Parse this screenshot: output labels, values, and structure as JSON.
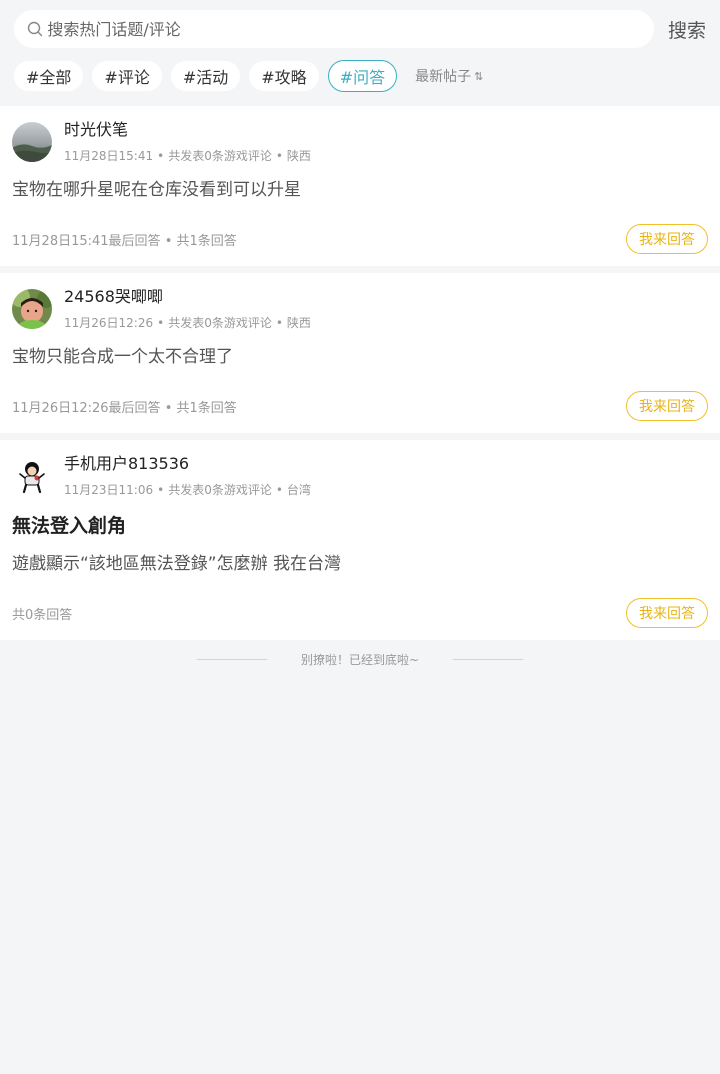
{
  "search": {
    "placeholder": "搜索热门话题/评论",
    "button_label": "搜索"
  },
  "filters": {
    "tags": [
      {
        "label": "#全部"
      },
      {
        "label": "#评论"
      },
      {
        "label": "#活动"
      },
      {
        "label": "#攻略"
      },
      {
        "label": "#问答"
      }
    ],
    "active_tag": "#问答",
    "sort_label": "最新帖子",
    "sort_icon": "⇅"
  },
  "colors": {
    "active_tag": "#3aafc3",
    "answer_button": "#e8b418",
    "background": "#f4f5f7"
  },
  "posts": [
    {
      "username": "时光伏笔",
      "time": "11月28日15:41",
      "comment_count": "共发表0条游戏评论",
      "location": "陕西",
      "title": "",
      "body": "宝物在哪升星呢在仓库没看到可以升星",
      "last_answer": "11月28日15:41最后回答",
      "answer_count": "共1条回答",
      "answer_button": "我来回答"
    },
    {
      "username": "24568哭唧唧",
      "time": "11月26日12:26",
      "comment_count": "共发表0条游戏评论",
      "location": "陕西",
      "title": "",
      "body": "宝物只能合成一个太不合理了",
      "last_answer": "11月26日12:26最后回答",
      "answer_count": "共1条回答",
      "answer_button": "我来回答"
    },
    {
      "username": "手机用户813536",
      "time": "11月23日11:06",
      "comment_count": "共发表0条游戏评论",
      "location": "台湾",
      "title": "無法登入創角",
      "body": "遊戲顯示“該地區無法登錄”怎麼辦 我在台灣",
      "last_answer": "",
      "answer_count": "共0条回答",
      "answer_button": "我来回答"
    }
  ],
  "footer": {
    "end_text": "别撩啦！已经到底啦~"
  }
}
